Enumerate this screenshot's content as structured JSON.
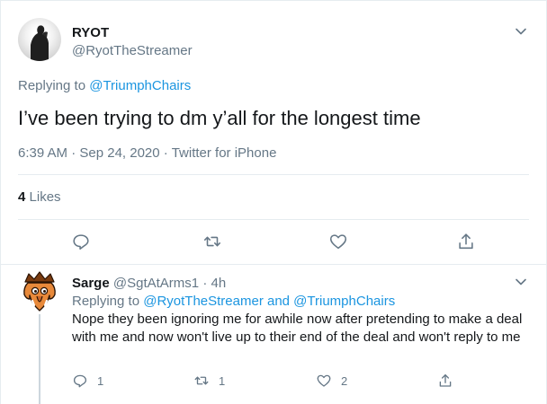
{
  "main_tweet": {
    "display_name": "RYOT",
    "handle": "@RyotTheStreamer",
    "replying_prefix": "Replying to",
    "replying_to": "@TriumphChairs",
    "text": "I’ve been trying to dm y’all for the longest time",
    "timestamp": "6:39 AM · Sep 24, 2020",
    "separator": "·",
    "source": "Twitter for iPhone",
    "likes_count": "4",
    "likes_label": "Likes",
    "actions": [
      "reply-icon",
      "retweet-icon",
      "like-icon",
      "share-icon"
    ]
  },
  "reply_tweet": {
    "display_name": "Sarge",
    "handle": "@SgtAtArms1",
    "time_sep": "·",
    "time": "4h",
    "replying_prefix": "Replying to",
    "replying_to": "@RyotTheStreamer and @TriumphChairs",
    "text": "Nope they been ignoring me for awhile now after pretending to make a deal with me and now won't live up to their end of the deal and won't reply to me",
    "reply_count": "1",
    "retweet_count": "1",
    "like_count": "2"
  },
  "colors": {
    "text_primary": "#14171a",
    "text_secondary": "#657786",
    "link": "#1b95e0",
    "border": "#e6ecf0"
  }
}
